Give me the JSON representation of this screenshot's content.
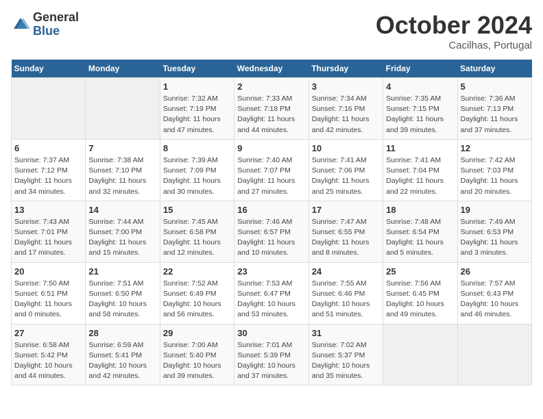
{
  "header": {
    "logo_general": "General",
    "logo_blue": "Blue",
    "month_title": "October 2024",
    "location": "Cacilhas, Portugal"
  },
  "days_of_week": [
    "Sunday",
    "Monday",
    "Tuesday",
    "Wednesday",
    "Thursday",
    "Friday",
    "Saturday"
  ],
  "weeks": [
    [
      {
        "day": "",
        "info": ""
      },
      {
        "day": "",
        "info": ""
      },
      {
        "day": "1",
        "info": "Sunrise: 7:32 AM\nSunset: 7:19 PM\nDaylight: 11 hours\nand 47 minutes."
      },
      {
        "day": "2",
        "info": "Sunrise: 7:33 AM\nSunset: 7:18 PM\nDaylight: 11 hours\nand 44 minutes."
      },
      {
        "day": "3",
        "info": "Sunrise: 7:34 AM\nSunset: 7:16 PM\nDaylight: 11 hours\nand 42 minutes."
      },
      {
        "day": "4",
        "info": "Sunrise: 7:35 AM\nSunset: 7:15 PM\nDaylight: 11 hours\nand 39 minutes."
      },
      {
        "day": "5",
        "info": "Sunrise: 7:36 AM\nSunset: 7:13 PM\nDaylight: 11 hours\nand 37 minutes."
      }
    ],
    [
      {
        "day": "6",
        "info": "Sunrise: 7:37 AM\nSunset: 7:12 PM\nDaylight: 11 hours\nand 34 minutes."
      },
      {
        "day": "7",
        "info": "Sunrise: 7:38 AM\nSunset: 7:10 PM\nDaylight: 11 hours\nand 32 minutes."
      },
      {
        "day": "8",
        "info": "Sunrise: 7:39 AM\nSunset: 7:09 PM\nDaylight: 11 hours\nand 30 minutes."
      },
      {
        "day": "9",
        "info": "Sunrise: 7:40 AM\nSunset: 7:07 PM\nDaylight: 11 hours\nand 27 minutes."
      },
      {
        "day": "10",
        "info": "Sunrise: 7:41 AM\nSunset: 7:06 PM\nDaylight: 11 hours\nand 25 minutes."
      },
      {
        "day": "11",
        "info": "Sunrise: 7:41 AM\nSunset: 7:04 PM\nDaylight: 11 hours\nand 22 minutes."
      },
      {
        "day": "12",
        "info": "Sunrise: 7:42 AM\nSunset: 7:03 PM\nDaylight: 11 hours\nand 20 minutes."
      }
    ],
    [
      {
        "day": "13",
        "info": "Sunrise: 7:43 AM\nSunset: 7:01 PM\nDaylight: 11 hours\nand 17 minutes."
      },
      {
        "day": "14",
        "info": "Sunrise: 7:44 AM\nSunset: 7:00 PM\nDaylight: 11 hours\nand 15 minutes."
      },
      {
        "day": "15",
        "info": "Sunrise: 7:45 AM\nSunset: 6:58 PM\nDaylight: 11 hours\nand 12 minutes."
      },
      {
        "day": "16",
        "info": "Sunrise: 7:46 AM\nSunset: 6:57 PM\nDaylight: 11 hours\nand 10 minutes."
      },
      {
        "day": "17",
        "info": "Sunrise: 7:47 AM\nSunset: 6:55 PM\nDaylight: 11 hours\nand 8 minutes."
      },
      {
        "day": "18",
        "info": "Sunrise: 7:48 AM\nSunset: 6:54 PM\nDaylight: 11 hours\nand 5 minutes."
      },
      {
        "day": "19",
        "info": "Sunrise: 7:49 AM\nSunset: 6:53 PM\nDaylight: 11 hours\nand 3 minutes."
      }
    ],
    [
      {
        "day": "20",
        "info": "Sunrise: 7:50 AM\nSunset: 6:51 PM\nDaylight: 11 hours\nand 0 minutes."
      },
      {
        "day": "21",
        "info": "Sunrise: 7:51 AM\nSunset: 6:50 PM\nDaylight: 10 hours\nand 58 minutes."
      },
      {
        "day": "22",
        "info": "Sunrise: 7:52 AM\nSunset: 6:49 PM\nDaylight: 10 hours\nand 56 minutes."
      },
      {
        "day": "23",
        "info": "Sunrise: 7:53 AM\nSunset: 6:47 PM\nDaylight: 10 hours\nand 53 minutes."
      },
      {
        "day": "24",
        "info": "Sunrise: 7:55 AM\nSunset: 6:46 PM\nDaylight: 10 hours\nand 51 minutes."
      },
      {
        "day": "25",
        "info": "Sunrise: 7:56 AM\nSunset: 6:45 PM\nDaylight: 10 hours\nand 49 minutes."
      },
      {
        "day": "26",
        "info": "Sunrise: 7:57 AM\nSunset: 6:43 PM\nDaylight: 10 hours\nand 46 minutes."
      }
    ],
    [
      {
        "day": "27",
        "info": "Sunrise: 6:58 AM\nSunset: 5:42 PM\nDaylight: 10 hours\nand 44 minutes."
      },
      {
        "day": "28",
        "info": "Sunrise: 6:59 AM\nSunset: 5:41 PM\nDaylight: 10 hours\nand 42 minutes."
      },
      {
        "day": "29",
        "info": "Sunrise: 7:00 AM\nSunset: 5:40 PM\nDaylight: 10 hours\nand 39 minutes."
      },
      {
        "day": "30",
        "info": "Sunrise: 7:01 AM\nSunset: 5:39 PM\nDaylight: 10 hours\nand 37 minutes."
      },
      {
        "day": "31",
        "info": "Sunrise: 7:02 AM\nSunset: 5:37 PM\nDaylight: 10 hours\nand 35 minutes."
      },
      {
        "day": "",
        "info": ""
      },
      {
        "day": "",
        "info": ""
      }
    ]
  ]
}
